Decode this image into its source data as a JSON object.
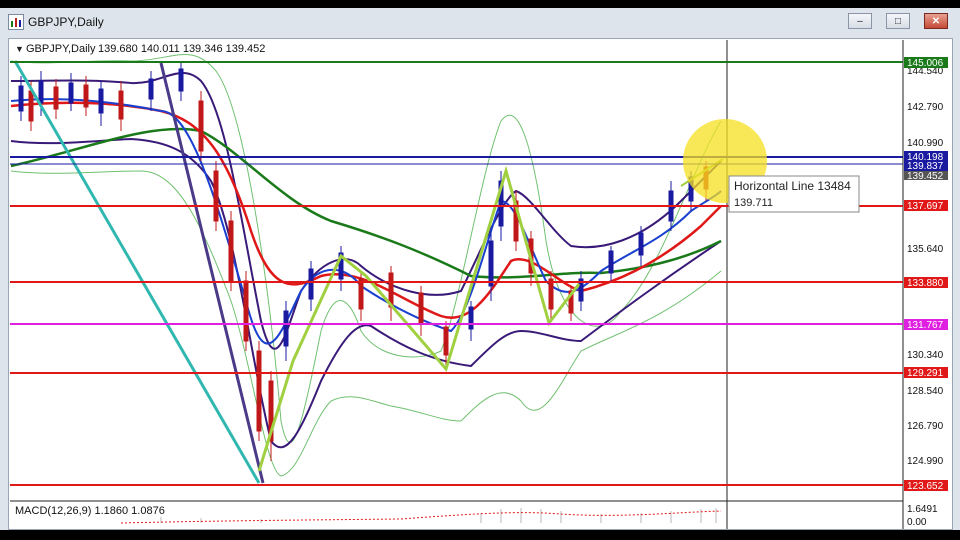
{
  "window": {
    "title": "GBPJPY,Daily",
    "buttons": {
      "minimize": "–",
      "maximize": "□",
      "close": "✕"
    }
  },
  "chart": {
    "symbol_header": "GBPJPY,Daily",
    "ohlc": "139.680 140.011 139.346 139.452",
    "indicator_label": "MACD(12,26,9) 1.1860 1.0876",
    "tooltip": {
      "line1": "Horizontal Line 13484",
      "line2": "139.711"
    },
    "price_scale": [
      "144.540",
      "142.790",
      "140.990",
      "135.640",
      "130.340",
      "128.540",
      "126.790",
      "124.990",
      "1.6491",
      "0.00"
    ],
    "hlines": [
      {
        "label": "145.006",
        "color": "#1a7a1a"
      },
      {
        "label": "140.198",
        "color": "#1a1aa0"
      },
      {
        "label": "139.837",
        "color": "#1a1aa0"
      },
      {
        "label": "139.452",
        "color": "#555555"
      },
      {
        "label": "137.697",
        "color": "#e01818"
      },
      {
        "label": "133.880",
        "color": "#e01818"
      },
      {
        "label": "131.767",
        "color": "#e020e0"
      },
      {
        "label": "129.291",
        "color": "#e01818"
      },
      {
        "label": "123.652",
        "color": "#e01818"
      }
    ]
  }
}
